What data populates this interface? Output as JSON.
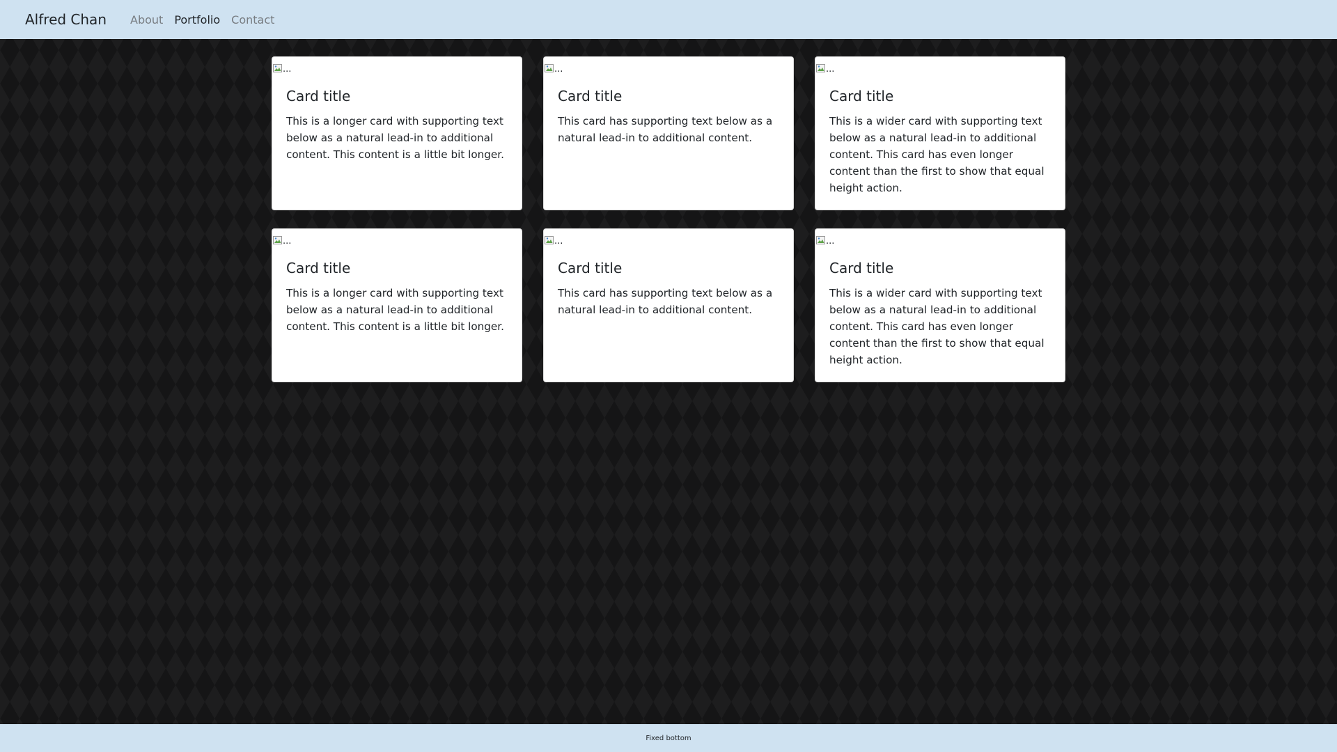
{
  "navbar": {
    "brand": "Alfred Chan",
    "links": [
      {
        "label": "About",
        "active": false
      },
      {
        "label": "Portfolio",
        "active": true
      },
      {
        "label": "Contact",
        "active": false
      }
    ]
  },
  "cards": [
    {
      "image_alt": "...",
      "title": "Card title",
      "text": "This is a longer card with supporting text below as a natural lead-in to additional content. This content is a little bit longer."
    },
    {
      "image_alt": "...",
      "title": "Card title",
      "text": "This card has supporting text below as a natural lead-in to additional content."
    },
    {
      "image_alt": "...",
      "title": "Card title",
      "text": "This is a wider card with supporting text below as a natural lead-in to additional content. This card has even longer content than the first to show that equal height action."
    },
    {
      "image_alt": "...",
      "title": "Card title",
      "text": "This is a longer card with supporting text below as a natural lead-in to additional content. This content is a little bit longer."
    },
    {
      "image_alt": "...",
      "title": "Card title",
      "text": "This card has supporting text below as a natural lead-in to additional content."
    },
    {
      "image_alt": "...",
      "title": "Card title",
      "text": "This is a wider card with supporting text below as a natural lead-in to additional content. This card has even longer content than the first to show that equal height action."
    }
  ],
  "footer": {
    "text": "Fixed bottom"
  },
  "colors": {
    "navbar_bg": "#cfe2f1",
    "page_bg": "#151516",
    "card_bg": "#ffffff",
    "text": "#212529",
    "muted_link": "#787d82"
  },
  "icons": {
    "card_image": "broken-image-icon"
  }
}
